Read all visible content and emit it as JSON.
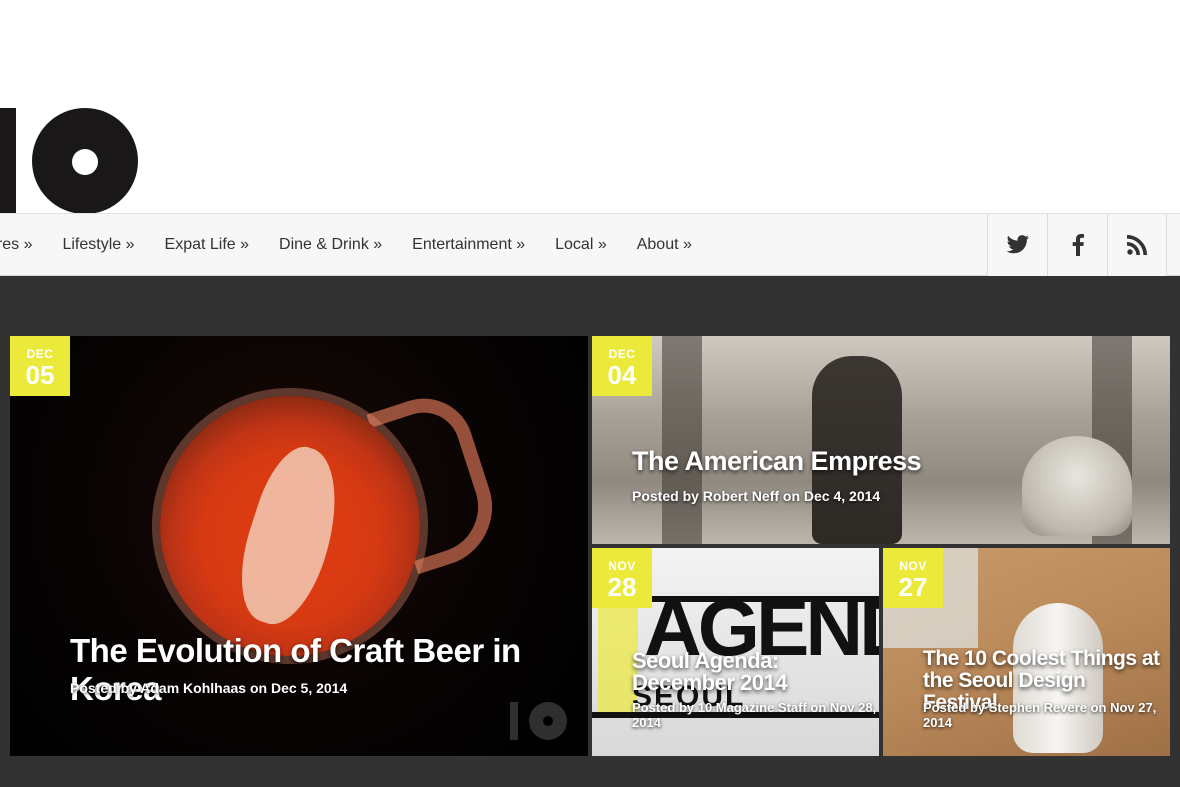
{
  "header": {
    "logo_name": "10 Magazine logo"
  },
  "nav": {
    "items": [
      {
        "label": "ures »"
      },
      {
        "label": "Lifestyle »"
      },
      {
        "label": "Expat Life »"
      },
      {
        "label": "Dine & Drink »"
      },
      {
        "label": "Entertainment »"
      },
      {
        "label": "Local »"
      },
      {
        "label": "About »"
      }
    ],
    "social": [
      {
        "icon": "twitter-icon"
      },
      {
        "icon": "facebook-icon"
      },
      {
        "icon": "rss-icon"
      }
    ]
  },
  "featured": {
    "posts": [
      {
        "month": "DEC",
        "day": "05",
        "title": "The Evolution of Craft Beer in Korea",
        "meta": "Posted by Adam Kohlhaas on Dec 5, 2014"
      },
      {
        "month": "DEC",
        "day": "04",
        "title": "The American Empress",
        "meta": "Posted by Robert Neff on Dec 4, 2014"
      },
      {
        "month": "NOV",
        "day": "28",
        "title": "Seoul Agenda: December 2014",
        "meta": "Posted by 10 Magazine Staff on Nov 28, 2014",
        "image_text": {
          "big": "AGENDA",
          "city": "SEOUL"
        }
      },
      {
        "month": "NOV",
        "day": "27",
        "title": "The 10 Coolest Things at the Seoul Design Festival",
        "meta": "Posted by Stephen Revere on Nov 27, 2014"
      }
    ]
  },
  "colors": {
    "badge": "#ebe93a",
    "featured_bg": "#323232",
    "nav_bg": "#f7f7f7"
  }
}
